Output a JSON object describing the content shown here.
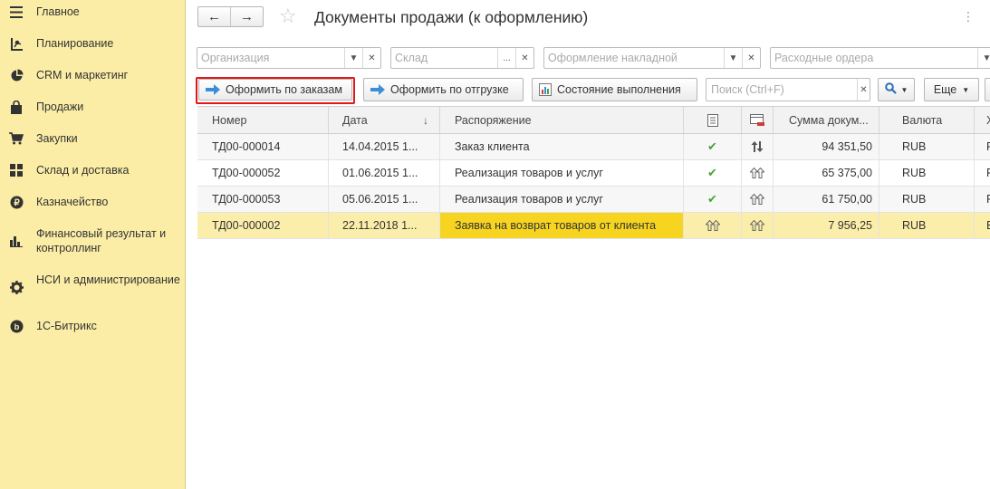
{
  "sidebar": {
    "items": [
      {
        "label": "Главное",
        "icon": "menu-lines-icon"
      },
      {
        "label": "Планирование",
        "icon": "planning-icon"
      },
      {
        "label": "CRM и маркетинг",
        "icon": "pie-chart-icon"
      },
      {
        "label": "Продажи",
        "icon": "shopping-bag-icon"
      },
      {
        "label": "Закупки",
        "icon": "cart-icon"
      },
      {
        "label": "Склад и доставка",
        "icon": "grid-icon"
      },
      {
        "label": "Казначейство",
        "icon": "coin-icon"
      },
      {
        "label": "Финансовый результат и контроллинг",
        "icon": "bar-chart-icon"
      },
      {
        "label": "НСИ и администрирование",
        "icon": "gear-icon"
      },
      {
        "label": "1С-Битрикс",
        "icon": "bitrix-icon"
      }
    ]
  },
  "header": {
    "back_label": "←",
    "forward_label": "→",
    "star_label": "☆",
    "title": "Документы продажи (к оформлению)",
    "more_label": "⋮"
  },
  "filters": {
    "organization_placeholder": "Организация",
    "warehouse_placeholder": "Склад",
    "invoice_placeholder": "Оформление накладной",
    "orders_placeholder": "Расходные ордера"
  },
  "toolbar": {
    "by_orders_label": "Оформить по заказам",
    "by_shipment_label": "Оформить по отгрузке",
    "status_label": "Состояние выполнения",
    "search_placeholder": "Поиск (Ctrl+F)",
    "more_label": "Еще",
    "help_label": "?"
  },
  "table": {
    "columns": {
      "number": "Номер",
      "date": "Дата",
      "disposition": "Распоряжение",
      "sum": "Сумма докум...",
      "currency": "Валюта",
      "extra": "Х"
    },
    "rows": [
      {
        "number": "ТД00-000014",
        "date": "14.04.2015 1...",
        "disposition": "Заказ клиента",
        "status": "check",
        "flow": "both-arrows",
        "sum": "94 351,50",
        "currency": "RUB",
        "extra": "F"
      },
      {
        "number": "ТД00-000052",
        "date": "01.06.2015 1...",
        "disposition": "Реализация товаров и услуг",
        "status": "check",
        "flow": "up-arrows",
        "sum": "65 375,00",
        "currency": "RUB",
        "extra": "F"
      },
      {
        "number": "ТД00-000053",
        "date": "05.06.2015 1...",
        "disposition": "Реализация товаров и услуг",
        "status": "check",
        "flow": "up-arrows",
        "sum": "61 750,00",
        "currency": "RUB",
        "extra": "F"
      },
      {
        "number": "ТД00-000002",
        "date": "22.11.2018 1...",
        "disposition": "Заявка на возврат товаров от клиента",
        "status": "up-arrows",
        "flow": "up-arrows",
        "sum": "7 956,25",
        "currency": "RUB",
        "extra": "E"
      }
    ]
  },
  "colors": {
    "sidebar_bg": "#fbeda6",
    "selected_row_bg": "#fbeeaa",
    "selected_cell_bg": "#f7d420",
    "highlight_border": "#e01818",
    "check_green": "#4aa13a"
  }
}
